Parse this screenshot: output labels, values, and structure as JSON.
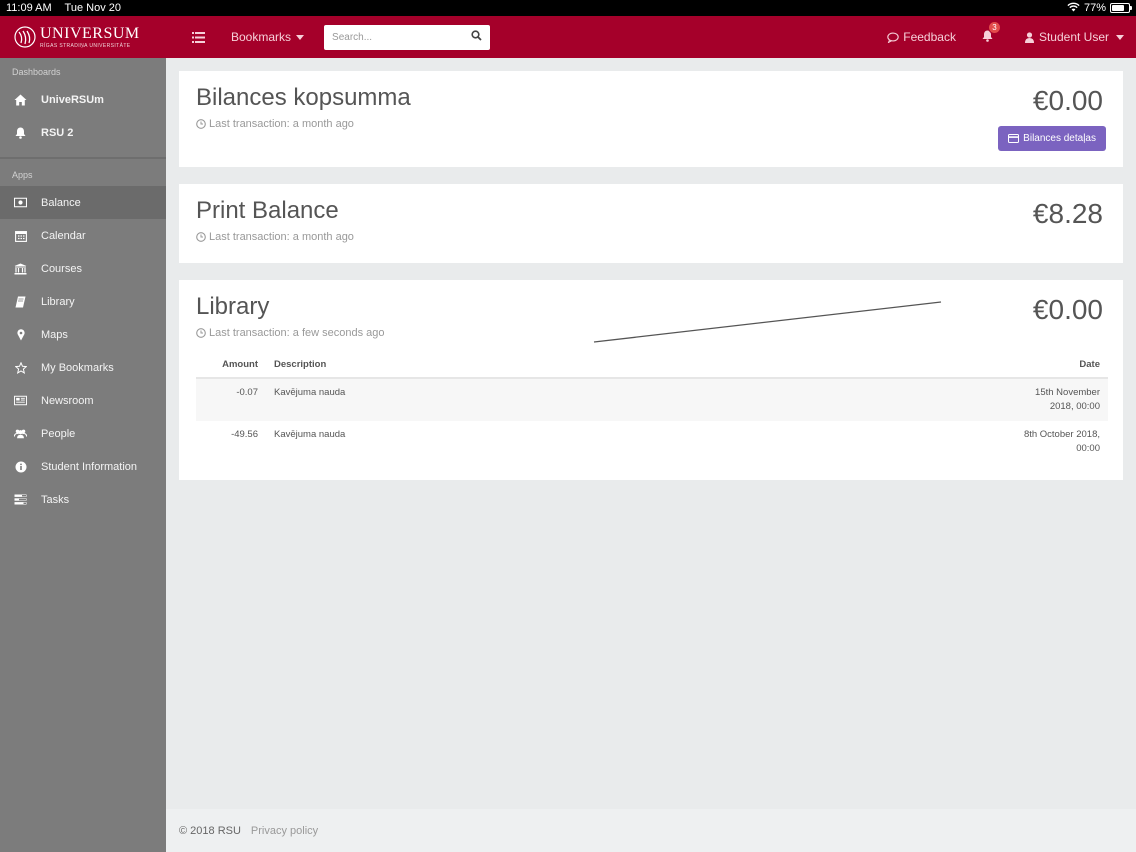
{
  "status_bar": {
    "time": "11:09 AM",
    "date": "Tue Nov 20",
    "battery": "77%",
    "battery_level": 0.77
  },
  "header": {
    "logo_main": "UNIVERSUM",
    "logo_sub": "RĪGAS STRADIŅA UNIVERSITĀTE",
    "bookmarks_label": "Bookmarks",
    "search_placeholder": "Search...",
    "feedback_label": "Feedback",
    "notification_count": "3",
    "user_label": "Student User"
  },
  "sidebar": {
    "dashboards_heading": "Dashboards",
    "dashboards": [
      {
        "label": "UniveRSUm",
        "icon": "home-icon"
      },
      {
        "label": "RSU 2",
        "icon": "bell-icon"
      }
    ],
    "apps_heading": "Apps",
    "apps": [
      {
        "label": "Balance",
        "icon": "money-icon",
        "active": true
      },
      {
        "label": "Calendar",
        "icon": "calendar-icon"
      },
      {
        "label": "Courses",
        "icon": "university-icon"
      },
      {
        "label": "Library",
        "icon": "book-icon"
      },
      {
        "label": "Maps",
        "icon": "map-marker-icon"
      },
      {
        "label": "My Bookmarks",
        "icon": "star-icon"
      },
      {
        "label": "Newsroom",
        "icon": "newspaper-icon"
      },
      {
        "label": "People",
        "icon": "users-icon"
      },
      {
        "label": "Student Information",
        "icon": "info-icon"
      },
      {
        "label": "Tasks",
        "icon": "tasks-icon"
      }
    ]
  },
  "cards": {
    "bilances": {
      "title": "Bilances kopsumma",
      "last_transaction": "Last transaction: a month ago",
      "amount": "€0.00",
      "details_button": "Bilances detaļas"
    },
    "print": {
      "title": "Print Balance",
      "last_transaction": "Last transaction: a month ago",
      "amount": "€8.28"
    },
    "library": {
      "title": "Library",
      "last_transaction": "Last transaction: a few seconds ago",
      "amount": "€0.00",
      "columns": {
        "amount": "Amount",
        "description": "Description",
        "date": "Date"
      },
      "rows": [
        {
          "amount": "-0.07",
          "description": "Kavējuma nauda",
          "date_line1": "15th November",
          "date_line2": "2018, 00:00"
        },
        {
          "amount": "-49.56",
          "description": "Kavējuma nauda",
          "date_line1": "8th October 2018,",
          "date_line2": "00:00"
        }
      ]
    }
  },
  "footer": {
    "copyright": "© 2018 RSU",
    "privacy_link": "Privacy policy"
  },
  "colors": {
    "brand": "#a5002a",
    "sidebar": "#7c7c7c",
    "button": "#7b63c0"
  }
}
